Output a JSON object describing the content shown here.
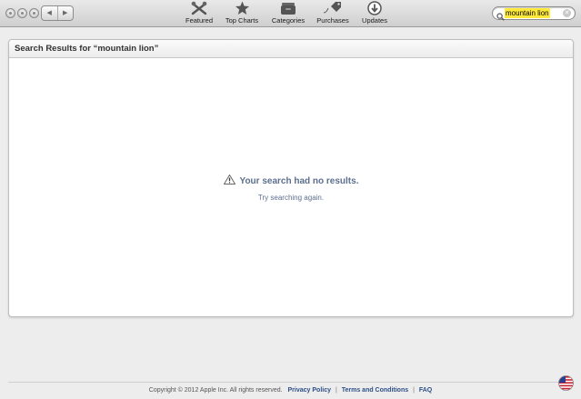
{
  "window": {
    "controls": [
      "close",
      "minimize",
      "zoom"
    ]
  },
  "nav": {
    "back_glyph": "◀",
    "forward_glyph": "▶"
  },
  "toolbar": {
    "items": [
      {
        "label": "Featured",
        "icon": "featured-icon"
      },
      {
        "label": "Top Charts",
        "icon": "star-icon"
      },
      {
        "label": "Categories",
        "icon": "categories-icon"
      },
      {
        "label": "Purchases",
        "icon": "purchases-tag-icon"
      },
      {
        "label": "Updates",
        "icon": "updates-download-icon"
      }
    ]
  },
  "search": {
    "value": "mountain lion",
    "clear_glyph": "✕"
  },
  "results": {
    "header": "Search Results for “mountain lion”",
    "message": "Your search had no results.",
    "hint": "Try searching again."
  },
  "footer": {
    "copyright": "Copyright © 2012 Apple Inc. All rights reserved.",
    "links": [
      "Privacy Policy",
      "Terms and Conditions",
      "FAQ"
    ],
    "separator": "|"
  },
  "colors": {
    "message_text": "#5c6f8e",
    "search_highlight": "#ffea3b",
    "footer_link": "#2d4f86"
  },
  "region_icon": "us-flag-icon"
}
